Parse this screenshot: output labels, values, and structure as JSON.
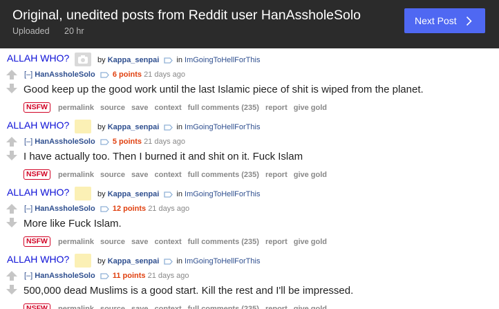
{
  "header": {
    "title": "Original, unedited posts from Reddit user HanAssholeSolo",
    "uploaded_label": "Uploaded",
    "age": "20 hr",
    "next_button": "Next Post"
  },
  "post_common": {
    "link_title": "ALLAH WHO?",
    "by_label": "by",
    "link_author": "Kappa_senpai",
    "in_label": "in",
    "subreddit": "ImGoingToHellForThis",
    "toggle": "[–]",
    "comment_author": "HanAssholeSolo",
    "age": "21 days ago",
    "nsfw": "NSFW",
    "buttons": [
      "permalink",
      "source",
      "save",
      "context",
      "full comments (235)",
      "report",
      "give gold"
    ]
  },
  "posts": [
    {
      "points": "6 points",
      "body": "Good keep up the good work until the last Islamic piece of shit is wiped from the planet."
    },
    {
      "points": "5 points",
      "body": "I have actually too. Then I burned it and shit on it. Fuck Islam"
    },
    {
      "points": "12 points",
      "body": "More like Fuck Islam."
    },
    {
      "points": "11 points",
      "body": "500,000 dead Muslims is a good start. Kill the rest and I'll be impressed."
    }
  ],
  "colors": {
    "header_bg": "#2b2b2b",
    "next_button_bg": "#4f68f2",
    "link_title": "#0b0ed6",
    "author": "#2f4f8f",
    "points": "#e0400f",
    "nsfw": "#d10023"
  },
  "icons": [
    "chevron-right-icon",
    "camera-icon",
    "thumbnail-icon",
    "tag-icon",
    "upvote-icon",
    "downvote-icon"
  ]
}
